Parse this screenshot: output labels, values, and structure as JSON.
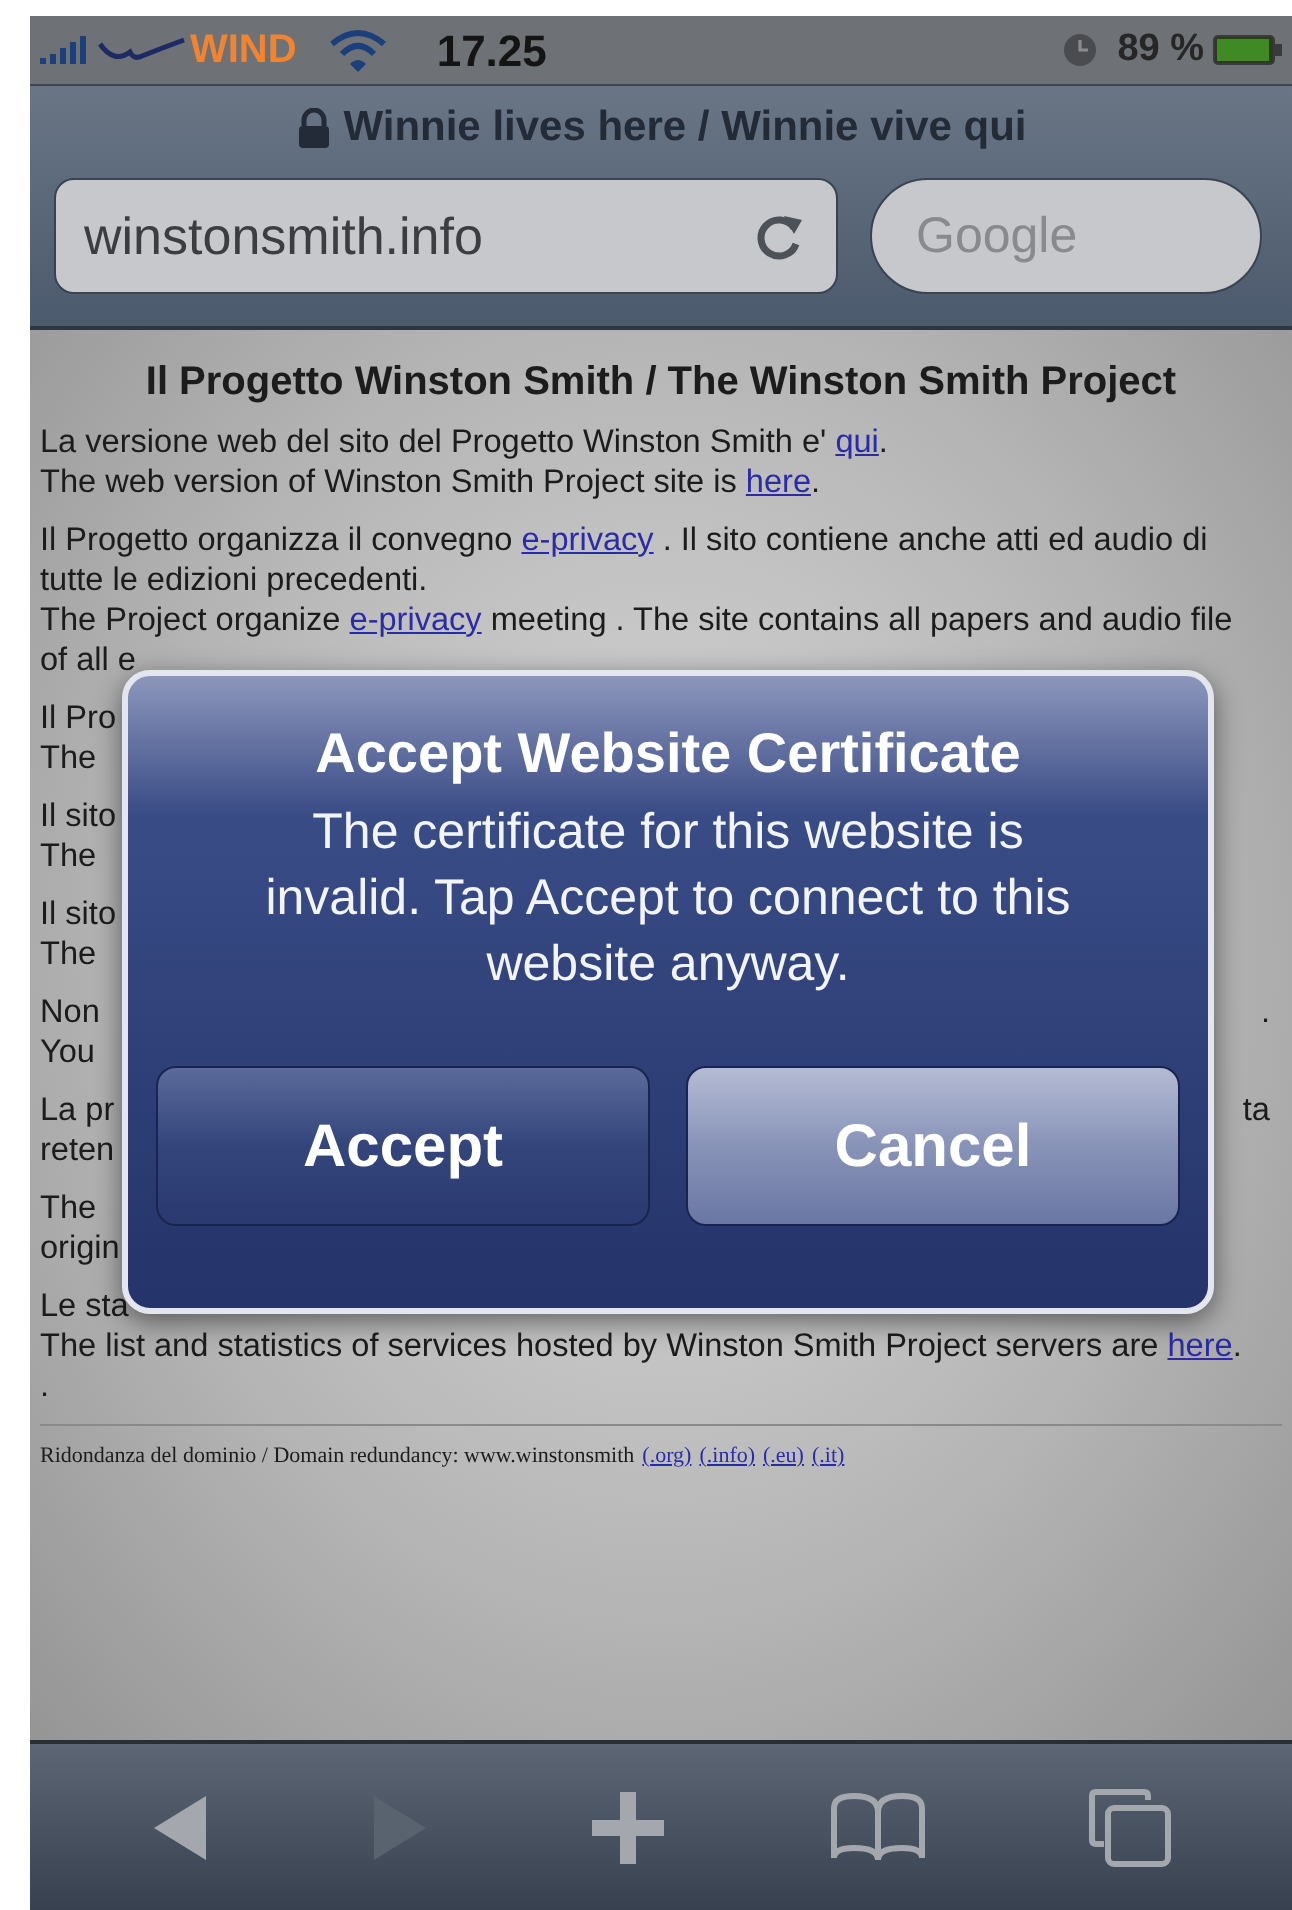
{
  "status_bar": {
    "carrier": "WIND",
    "time": "17.25",
    "battery": "89 %"
  },
  "nav_bar": {
    "title": "Winnie lives here / Winnie vive qui",
    "address": {
      "value": "winstonsmith.info"
    },
    "search": {
      "placeholder": "Google"
    }
  },
  "page": {
    "heading": "Il Progetto Winston Smith / The Winston Smith Project",
    "paragraphs": [
      {
        "lines": [
          {
            "kind": "text",
            "segments": [
              {
                "text": "La versione web del sito del Progetto Winston Smith e' ",
                "kind": "plain"
              },
              {
                "text": "qui",
                "kind": "link"
              },
              {
                "text": ".",
                "kind": "plain"
              }
            ]
          },
          {
            "kind": "text",
            "segments": [
              {
                "text": "The web version of Winston Smith Project site is ",
                "kind": "plain"
              },
              {
                "text": "here",
                "kind": "link"
              },
              {
                "text": ".",
                "kind": "plain"
              }
            ]
          }
        ]
      },
      {
        "lines": [
          {
            "kind": "text",
            "segments": [
              {
                "text": "Il Progetto organizza il convegno ",
                "kind": "plain"
              },
              {
                "text": "e-privacy",
                "kind": "link"
              },
              {
                "text": " . Il sito contiene anche atti ed audio di",
                "kind": "plain"
              }
            ]
          },
          {
            "kind": "text",
            "segments": [
              {
                "text": "tutte le edizioni precedenti.",
                "kind": "plain"
              }
            ]
          },
          {
            "kind": "text",
            "segments": [
              {
                "text": "The Project organize ",
                "kind": "plain"
              },
              {
                "text": "e-privacy",
                "kind": "link"
              },
              {
                "text": " meeting . The site contains all papers and audio file",
                "kind": "plain"
              }
            ]
          },
          {
            "kind": "obscured",
            "left": "of all e"
          }
        ]
      },
      {
        "lines": [
          {
            "kind": "obscured",
            "left": "Il Pro"
          },
          {
            "kind": "obscured",
            "left": "The"
          }
        ]
      },
      {
        "lines": [
          {
            "kind": "obscured",
            "left": "Il sito"
          },
          {
            "kind": "obscured",
            "left": "The"
          }
        ]
      },
      {
        "lines": [
          {
            "kind": "obscured",
            "left": "Il sito"
          },
          {
            "kind": "obscured",
            "left": "The"
          }
        ]
      },
      {
        "lines": [
          {
            "kind": "obscured",
            "left": "Non",
            "right": "."
          },
          {
            "kind": "obscured",
            "left": "You"
          }
        ]
      },
      {
        "lines": [
          {
            "kind": "obscured",
            "left": "La pr",
            "right": "ta"
          },
          {
            "kind": "obscured",
            "left": "reten"
          }
        ]
      },
      {
        "lines": [
          {
            "kind": "obscured",
            "left": "The"
          },
          {
            "kind": "obscured",
            "left": "origin"
          }
        ]
      },
      {
        "lines": [
          {
            "kind": "obscured",
            "left": "Le sta"
          },
          {
            "kind": "text",
            "segments": [
              {
                "text": "The list and statistics of services hosted by Winston Smith Project servers are ",
                "kind": "plain"
              },
              {
                "text": "here",
                "kind": "link"
              },
              {
                "text": ".",
                "kind": "plain"
              }
            ]
          },
          {
            "kind": "text",
            "segments": [
              {
                "text": ".",
                "kind": "plain"
              }
            ]
          }
        ]
      }
    ],
    "footer": {
      "segments": [
        {
          "text": "Ridondanza del dominio / Domain redundancy: www.winstonsmith",
          "kind": "plain"
        },
        {
          "text": "(.org)",
          "kind": "link"
        },
        {
          "text": "(.info)",
          "kind": "link"
        },
        {
          "text": "(.eu)",
          "kind": "link"
        },
        {
          "text": "(.it)",
          "kind": "link"
        }
      ]
    }
  },
  "alert": {
    "title": "Accept Website Certificate",
    "message": "The certificate for this website is invalid. Tap Accept to connect to this website anyway.",
    "buttons": [
      {
        "label": "Accept",
        "kind": "normal"
      },
      {
        "label": "Cancel",
        "kind": "cancel"
      }
    ]
  },
  "toolbar": [
    {
      "kind": "back",
      "disabled": false
    },
    {
      "kind": "forward",
      "disabled": true
    },
    {
      "kind": "add",
      "disabled": false
    },
    {
      "kind": "bookmarks",
      "disabled": false
    },
    {
      "kind": "pages",
      "disabled": false
    }
  ]
}
